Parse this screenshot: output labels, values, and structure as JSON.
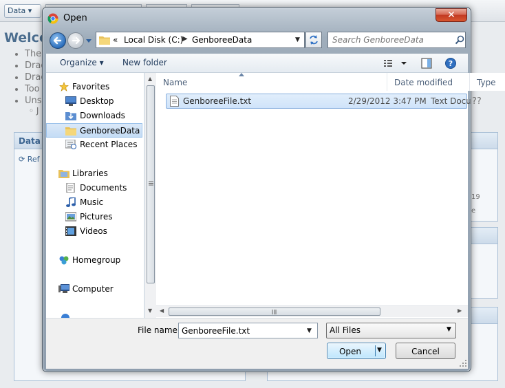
{
  "background_page": {
    "data_button": "Data",
    "welcome": "Welco",
    "bullets": [
      "The",
      "Drag",
      "Drag",
      "Too",
      "Uns"
    ],
    "sub_bullet": "J",
    "panel_header": "Data S",
    "refresh_label": "Ref",
    "right_fragment_1": "19",
    "right_fragment_2": "e",
    "question_fragment": "??"
  },
  "dialog": {
    "title": "Open",
    "close_symbol": "✕",
    "breadcrumb": {
      "overflow": "«",
      "items": [
        "Local Disk (C:)",
        "GenboreeData"
      ]
    },
    "search": {
      "placeholder": "Search GenboreeData",
      "value": ""
    },
    "command_bar": {
      "organize": "Organize ▾",
      "new_folder": "New folder"
    },
    "nav_pane": {
      "favorites": {
        "label": "Favorites",
        "items": [
          "Desktop",
          "Downloads",
          "GenboreeData",
          "Recent Places"
        ]
      },
      "libraries": {
        "label": "Libraries",
        "items": [
          "Documents",
          "Music",
          "Pictures",
          "Videos"
        ]
      },
      "homegroup": "Homegroup",
      "computer": "Computer"
    },
    "columns": [
      "Name",
      "Date modified",
      "Type"
    ],
    "files": [
      {
        "name": "GenboreeFile.txt",
        "date_modified": "2/29/2012 3:47 PM",
        "type": "Text Docu"
      }
    ],
    "file_name_label": "File name:",
    "file_name_value": "GenboreeFile.txt",
    "file_type_filter": "All Files",
    "open_button": "Open",
    "cancel_button": "Cancel"
  },
  "colors": {
    "selection": "#cfe3fa",
    "selection_border": "#84acdd",
    "close_red": "#c23a22",
    "chrome_frame": "#9fadbb"
  }
}
